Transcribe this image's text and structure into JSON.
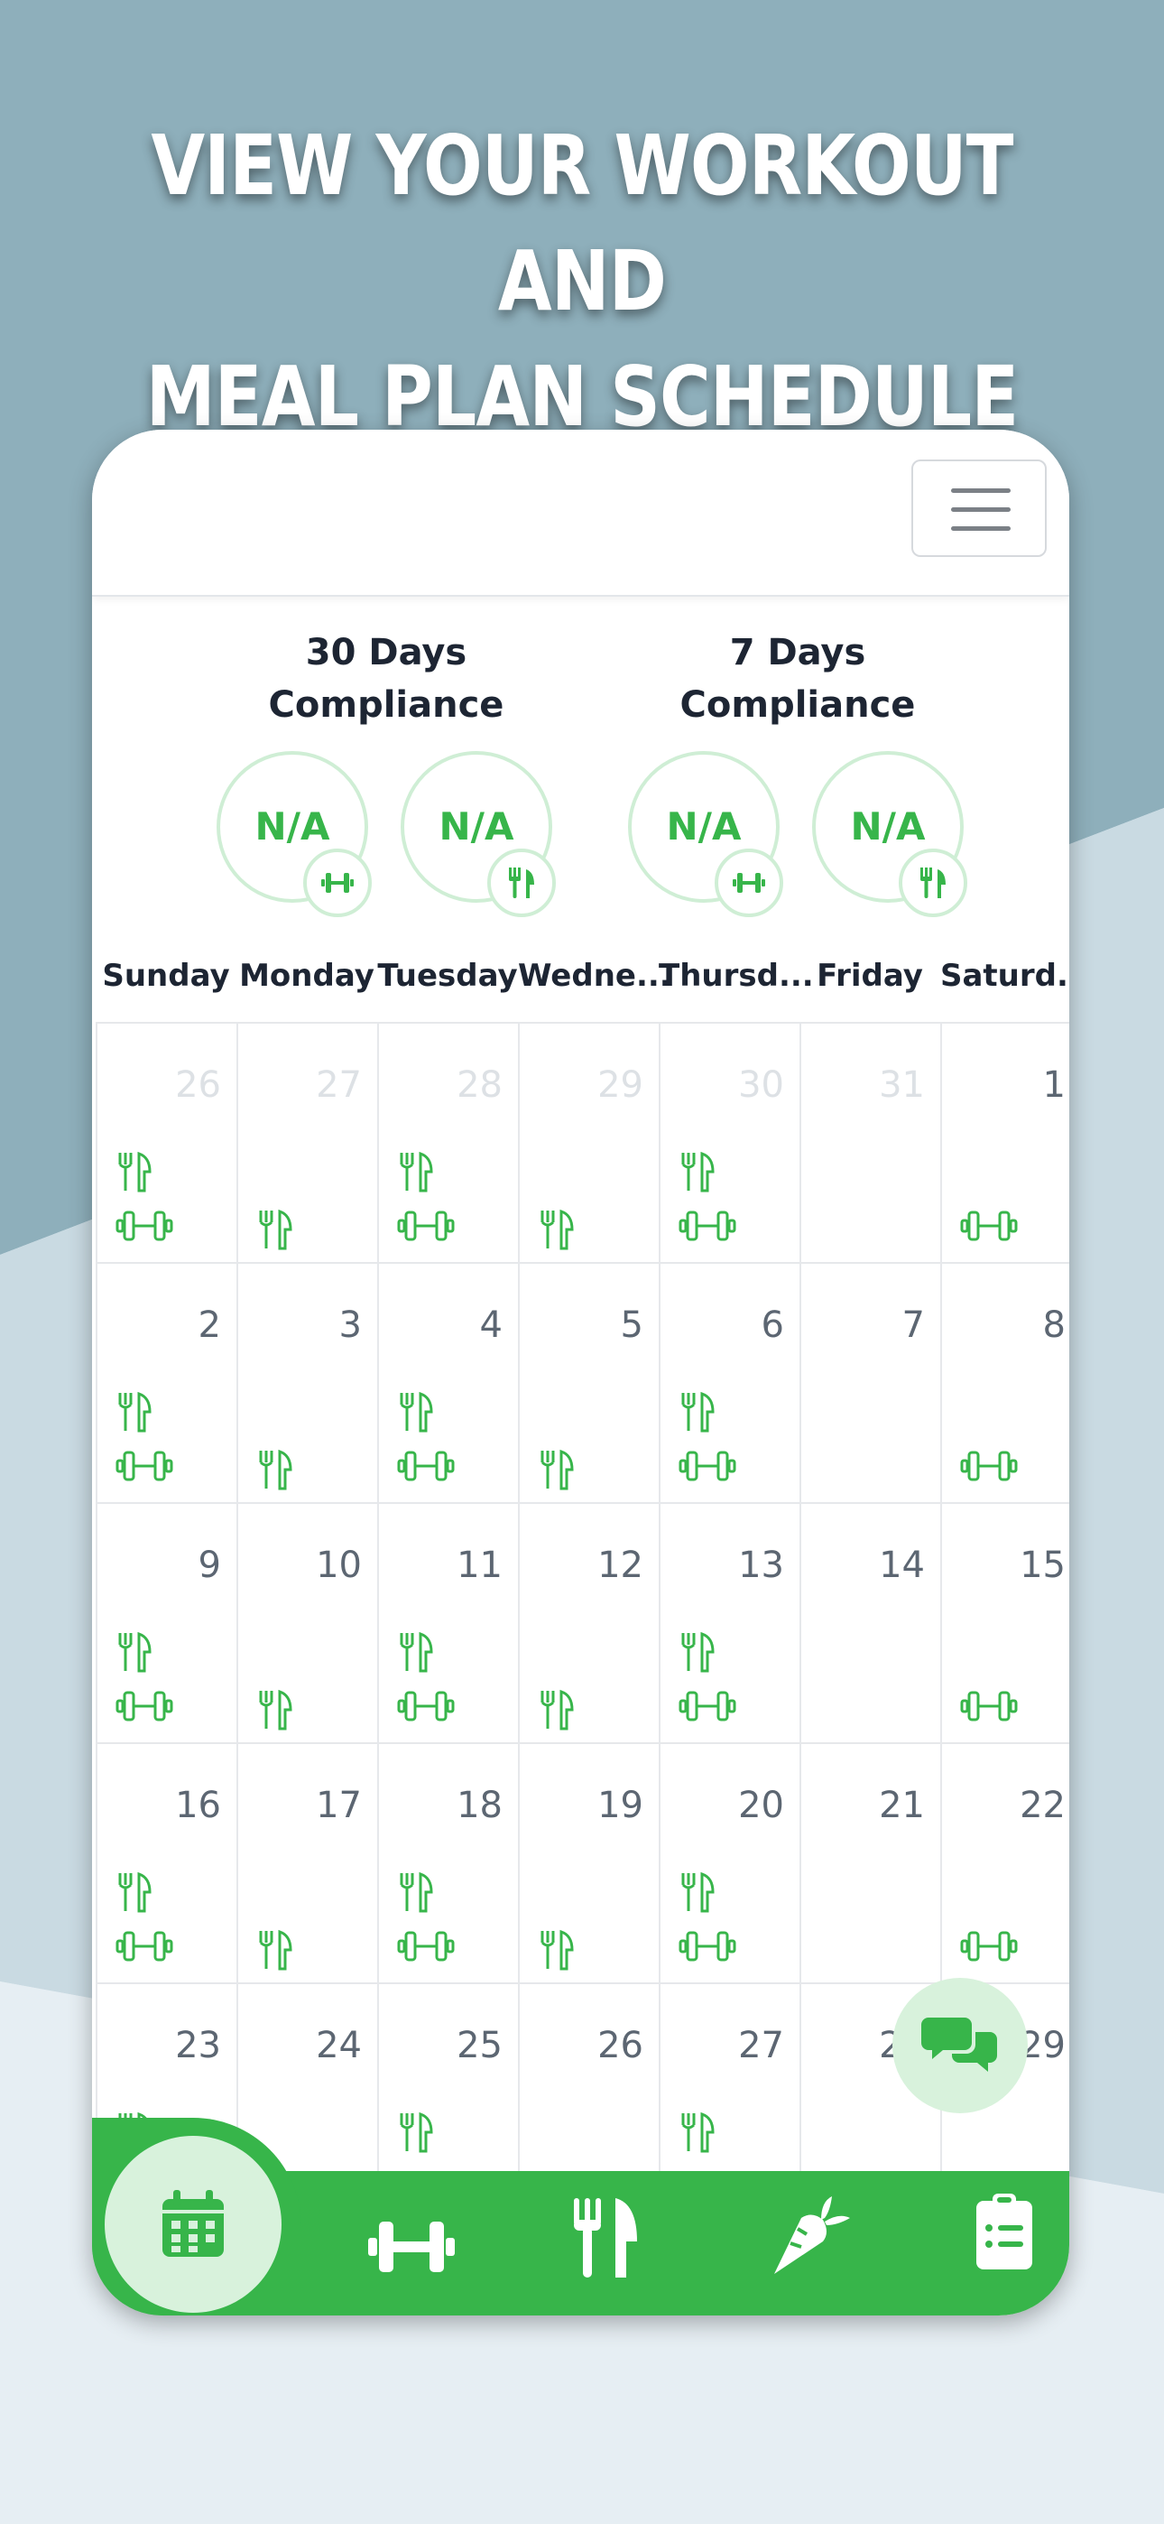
{
  "headline": {
    "line1": "VIEW YOUR WORKOUT AND",
    "line2": "MEAL PLAN SCHEDULE"
  },
  "colors": {
    "accent": "#37b54a",
    "accent_light": "#d8f2dc",
    "ring_border": "#cfeed5",
    "text_dark": "#1d2533",
    "text_day": "#5c6672",
    "text_dim": "#dde1e5"
  },
  "menu_icon": "hamburger-menu-icon",
  "compliance": [
    {
      "title_line1": "30 Days",
      "title_line2": "Compliance",
      "workout_value": "N/A",
      "meal_value": "N/A"
    },
    {
      "title_line1": "7 Days",
      "title_line2": "Compliance",
      "workout_value": "N/A",
      "meal_value": "N/A"
    }
  ],
  "weekdays": [
    "Sunday",
    "Monday",
    "Tuesday",
    "Wedne...",
    "Thursd...",
    "Friday",
    "Saturd..."
  ],
  "calendar": {
    "weeks": [
      [
        {
          "day": "26",
          "dim": true,
          "meal": "top",
          "gym": true
        },
        {
          "day": "27",
          "dim": true,
          "meal": "bottom",
          "gym": false
        },
        {
          "day": "28",
          "dim": true,
          "meal": "top",
          "gym": true
        },
        {
          "day": "29",
          "dim": true,
          "meal": "bottom",
          "gym": false
        },
        {
          "day": "30",
          "dim": true,
          "meal": "top",
          "gym": true
        },
        {
          "day": "31",
          "dim": true,
          "meal": "none",
          "gym": false
        },
        {
          "day": "1",
          "dim": false,
          "meal": "none",
          "gym": true
        }
      ],
      [
        {
          "day": "2",
          "dim": false,
          "meal": "top",
          "gym": true
        },
        {
          "day": "3",
          "dim": false,
          "meal": "bottom",
          "gym": false
        },
        {
          "day": "4",
          "dim": false,
          "meal": "top",
          "gym": true
        },
        {
          "day": "5",
          "dim": false,
          "meal": "bottom",
          "gym": false
        },
        {
          "day": "6",
          "dim": false,
          "meal": "top",
          "gym": true
        },
        {
          "day": "7",
          "dim": false,
          "meal": "none",
          "gym": false
        },
        {
          "day": "8",
          "dim": false,
          "meal": "none",
          "gym": true
        }
      ],
      [
        {
          "day": "9",
          "dim": false,
          "meal": "top",
          "gym": true
        },
        {
          "day": "10",
          "dim": false,
          "meal": "bottom",
          "gym": false
        },
        {
          "day": "11",
          "dim": false,
          "meal": "top",
          "gym": true
        },
        {
          "day": "12",
          "dim": false,
          "meal": "bottom",
          "gym": false
        },
        {
          "day": "13",
          "dim": false,
          "meal": "top",
          "gym": true
        },
        {
          "day": "14",
          "dim": false,
          "meal": "none",
          "gym": false
        },
        {
          "day": "15",
          "dim": false,
          "meal": "none",
          "gym": true
        }
      ],
      [
        {
          "day": "16",
          "dim": false,
          "meal": "top",
          "gym": true
        },
        {
          "day": "17",
          "dim": false,
          "meal": "bottom",
          "gym": false
        },
        {
          "day": "18",
          "dim": false,
          "meal": "top",
          "gym": true
        },
        {
          "day": "19",
          "dim": false,
          "meal": "bottom",
          "gym": false
        },
        {
          "day": "20",
          "dim": false,
          "meal": "top",
          "gym": true
        },
        {
          "day": "21",
          "dim": false,
          "meal": "none",
          "gym": false
        },
        {
          "day": "22",
          "dim": false,
          "meal": "none",
          "gym": true
        }
      ],
      [
        {
          "day": "23",
          "dim": false,
          "meal": "top",
          "gym": false
        },
        {
          "day": "24",
          "dim": false,
          "meal": "none",
          "gym": false
        },
        {
          "day": "25",
          "dim": false,
          "meal": "top",
          "gym": false
        },
        {
          "day": "26",
          "dim": false,
          "meal": "none",
          "gym": false
        },
        {
          "day": "27",
          "dim": false,
          "meal": "top",
          "gym": false
        },
        {
          "day": "28",
          "dim": false,
          "meal": "none",
          "gym": false
        },
        {
          "day": "29",
          "dim": false,
          "meal": "none",
          "gym": false
        }
      ]
    ]
  },
  "chat_icon": "chat-bubbles-icon",
  "bottom_nav": [
    {
      "icon": "calendar-icon",
      "active": true
    },
    {
      "icon": "dumbbell-icon",
      "active": false
    },
    {
      "icon": "fork-knife-icon",
      "active": false
    },
    {
      "icon": "carrot-icon",
      "active": false
    },
    {
      "icon": "clipboard-list-icon",
      "active": false
    }
  ]
}
